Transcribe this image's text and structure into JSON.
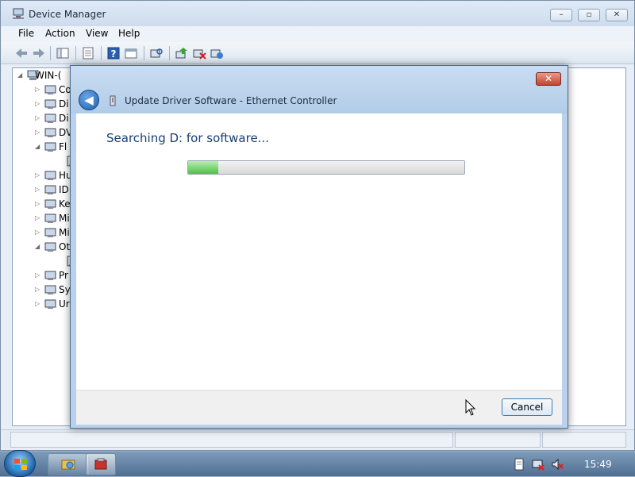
{
  "window": {
    "title": "Device Manager",
    "minimize": "–",
    "maximize": "▫",
    "close": "✕"
  },
  "menu": {
    "file": "File",
    "action": "Action",
    "view": "View",
    "help": "Help"
  },
  "tree": {
    "root_label": "WIN-(",
    "rows": [
      {
        "label": "Co",
        "icon": "computer-icon",
        "expander": "▷"
      },
      {
        "label": "Di",
        "icon": "disk-drive-icon",
        "expander": "▷"
      },
      {
        "label": "Di",
        "icon": "display-adapter-icon",
        "expander": "▷"
      },
      {
        "label": "DV",
        "icon": "dvd-drive-icon",
        "expander": "▷"
      },
      {
        "label": "Fl",
        "icon": "floppy-controller-icon",
        "expander": "◢"
      },
      {
        "label": "",
        "icon": "warning-device-icon",
        "expander": ""
      },
      {
        "label": "Hu",
        "icon": "hid-icon",
        "expander": "▷"
      },
      {
        "label": "ID",
        "icon": "ide-controller-icon",
        "expander": "▷"
      },
      {
        "label": "Ke",
        "icon": "keyboard-icon",
        "expander": "▷"
      },
      {
        "label": "Mi",
        "icon": "mouse-icon",
        "expander": "▷"
      },
      {
        "label": "Mi",
        "icon": "monitor-icon",
        "expander": "▷"
      },
      {
        "label": "Ot",
        "icon": "other-devices-icon",
        "expander": "◢"
      },
      {
        "label": "",
        "icon": "warning-device-icon",
        "expander": ""
      },
      {
        "label": "Pr",
        "icon": "processor-icon",
        "expander": "▷"
      },
      {
        "label": "Sy",
        "icon": "system-device-icon",
        "expander": "▷"
      },
      {
        "label": "Ur",
        "icon": "usb-controller-icon",
        "expander": "▷"
      }
    ]
  },
  "dialog": {
    "title": "Update Driver Software - Ethernet Controller",
    "searching_text": "Searching D: for software...",
    "progress_fraction": 0.11,
    "cancel_label": "Cancel",
    "close": "✕",
    "back": "◀"
  },
  "taskbar": {
    "clock": "15:49"
  },
  "colors": {
    "dialog_heading": "#1b3f72",
    "progress_green": "#4ec244",
    "close_red": "#c5432c"
  }
}
